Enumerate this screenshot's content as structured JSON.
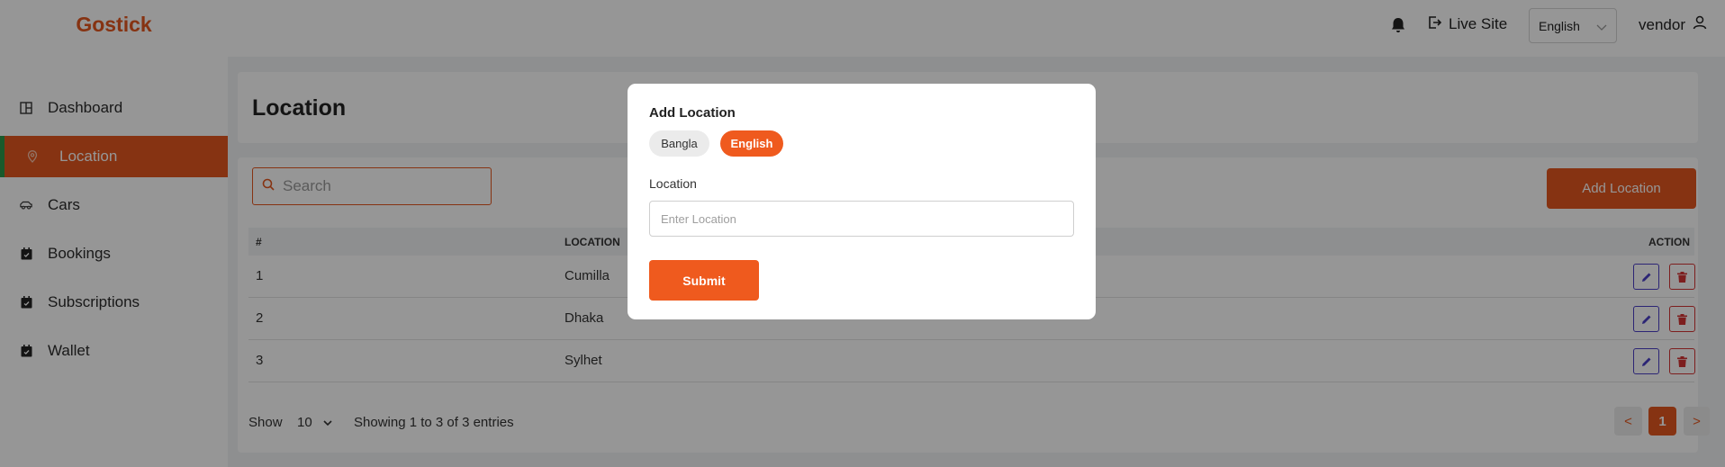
{
  "brand": "Gostick",
  "sidebar": {
    "items": [
      {
        "label": "Dashboard",
        "icon": "dashboard-icon"
      },
      {
        "label": "Location",
        "icon": "map-pin-icon",
        "active": true
      },
      {
        "label": "Cars",
        "icon": "car-icon"
      },
      {
        "label": "Bookings",
        "icon": "calendar-icon"
      },
      {
        "label": "Subscriptions",
        "icon": "calendar-icon"
      },
      {
        "label": "Wallet",
        "icon": "calendar-icon"
      }
    ]
  },
  "header": {
    "live_site": "Live Site",
    "language": "English",
    "user": "vendor"
  },
  "main": {
    "title": "Location",
    "search_placeholder": "Search",
    "add_button": "Add Location",
    "columns": [
      "#",
      "LOCATION",
      "ACTION"
    ],
    "rows": [
      {
        "num": "1",
        "location": "Cumilla"
      },
      {
        "num": "2",
        "location": "Dhaka"
      },
      {
        "num": "3",
        "location": "Sylhet"
      }
    ],
    "footer": {
      "show_label": "Show",
      "page_size": "10",
      "entries": "Showing 1 to 3 of 3 entries",
      "prev": "<",
      "current_page": "1",
      "next": ">"
    }
  },
  "modal": {
    "title": "Add Location",
    "lang_tabs": [
      "Bangla",
      "English"
    ],
    "active_tab": "English",
    "field_label": "Location",
    "field_placeholder": "Enter Location",
    "submit": "Submit"
  },
  "colors": {
    "accent": "#e4571f",
    "active_border": "#2c9a4a",
    "edit": "#4b3fc7",
    "delete": "#d53434"
  }
}
